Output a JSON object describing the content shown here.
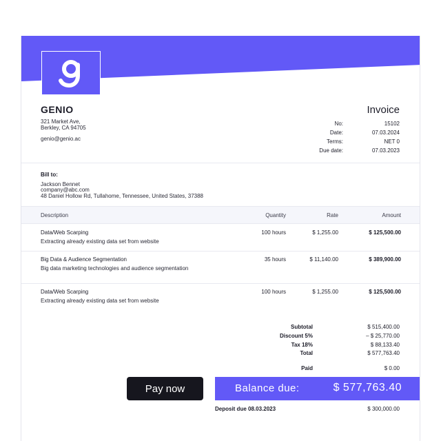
{
  "brand": {
    "logo_letter": "g",
    "accent": "#6259f7"
  },
  "company": {
    "name": "GENIO",
    "address_line1": "321 Market Ave,",
    "address_line2": "Berkley, CA 94705",
    "email": "genio@genio.ac"
  },
  "invoice": {
    "title": "Invoice",
    "meta": [
      {
        "label": "No:",
        "value": "15102"
      },
      {
        "label": "Date:",
        "value": "07.03.2024"
      },
      {
        "label": "Terms:",
        "value": "NET 0"
      },
      {
        "label": "Due date:",
        "value": "07.03.2023"
      }
    ]
  },
  "bill_to": {
    "title": "Bill to:",
    "name": "Jackson Bennet",
    "email": "company@abc.com",
    "address": "48 Daniel Hollow Rd, Tullahome, Tennessee, United States, 37388"
  },
  "table": {
    "headers": {
      "description": "Description",
      "quantity": "Quantity",
      "rate": "Rate",
      "amount": "Amount"
    },
    "rows": [
      {
        "title": "Data/Web Scarping",
        "detail": "Extracting already existing data set from website",
        "quantity": "100 hours",
        "rate": "$ 1,255.00",
        "amount": "$ 125,500.00"
      },
      {
        "title": "Big Data & Audience Segmentation",
        "detail": "Big data marketing technologies and audience segmentation",
        "quantity": "35 hours",
        "rate": "$ 11,140.00",
        "amount": "$ 389,900.00"
      },
      {
        "title": "Data/Web Scarping",
        "detail": "Extracting already existing data set from website",
        "quantity": "100 hours",
        "rate": "$ 1,255.00",
        "amount": "$ 125,500.00"
      }
    ]
  },
  "totals": [
    {
      "label": "Subtotal",
      "value": "$ 515,400.00"
    },
    {
      "label": "Discount 5%",
      "value": "– $ 25,770.00"
    },
    {
      "label": "Tax 18%",
      "value": "$ 88,133.40"
    },
    {
      "label": "Total",
      "value": "$ 577,763.40"
    },
    {
      "label": "Paid",
      "value": "$ 0.00"
    }
  ],
  "actions": {
    "pay_now_label": "Pay now"
  },
  "balance": {
    "label": "Balance due:",
    "value": "$ 577,763.40"
  },
  "deposit": {
    "label": "Deposit due 08.03.2023",
    "value": "$ 300,000.00"
  }
}
